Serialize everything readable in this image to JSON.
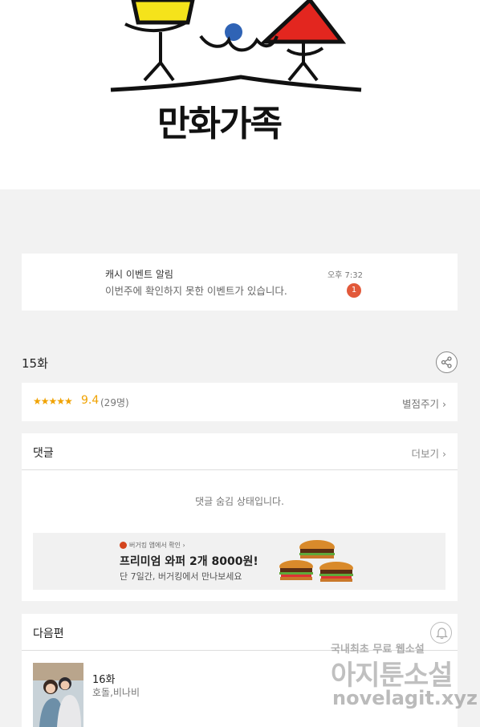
{
  "logo": {
    "text": "만화가족"
  },
  "notification": {
    "title": "캐시 이벤트 알림",
    "message": "이번주에 확인하지 못한 이벤트가 있습니다.",
    "time": "오후 7:32",
    "badge_count": "1"
  },
  "episode": {
    "title": "15화",
    "share_icon": "share-icon"
  },
  "rating": {
    "stars": "★★★★★",
    "rating_value": 9.4,
    "score": "9.4",
    "count": "(29명)",
    "rate_button": "별점주기 ›"
  },
  "comments": {
    "title": "댓글",
    "more": "더보기 ›",
    "hidden_message": "댓글 숨김 상태입니다."
  },
  "ad": {
    "brand": "버거킹 앱에서 확인 ›",
    "title": "프리미엄 와퍼 2개 8000원!",
    "subtitle": "단 7일간, 버거킹에서 만나보세요"
  },
  "next": {
    "title": "다음편",
    "bell_icon": "bell-icon",
    "episode": "16화",
    "author": "호돌,비나비"
  },
  "watermark": {
    "line1": "국내최초 무료 웹소설",
    "line2": "아지툰소설",
    "line3": "novelagit.xyz"
  }
}
